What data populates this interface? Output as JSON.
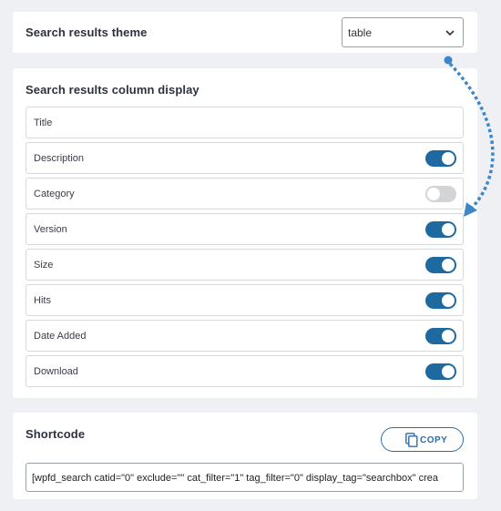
{
  "theme": {
    "label": "Search results theme",
    "selected": "table"
  },
  "columns": {
    "title": "Search results column display",
    "items": [
      {
        "label": "Title",
        "toggle": null
      },
      {
        "label": "Description",
        "toggle": "on"
      },
      {
        "label": "Category",
        "toggle": "off"
      },
      {
        "label": "Version",
        "toggle": "on"
      },
      {
        "label": "Size",
        "toggle": "on"
      },
      {
        "label": "Hits",
        "toggle": "on"
      },
      {
        "label": "Date Added",
        "toggle": "on"
      },
      {
        "label": "Download",
        "toggle": "on"
      }
    ]
  },
  "shortcode": {
    "title": "Shortcode",
    "copy_label": "COPY",
    "value": "[wpfd_search catid=\"0\" exclude=\"\" cat_filter=\"1\" tag_filter=\"0\" display_tag=\"searchbox\" crea"
  },
  "colors": {
    "accent": "#1e6aa0",
    "toggle_off": "#d3d4d6",
    "arrow": "#3d87c9"
  }
}
